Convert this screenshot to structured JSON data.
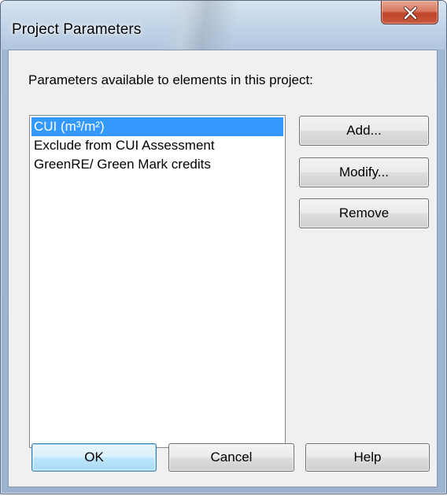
{
  "window": {
    "title": "Project Parameters",
    "colors": {
      "selection": "#3399ff",
      "close_button": "#c0432a",
      "default_button": "#3c7fb1"
    }
  },
  "dialog": {
    "caption": "Parameters available to elements in this project:",
    "parameters": [
      {
        "label": "CUI (m³/m²)",
        "selected": true
      },
      {
        "label": "Exclude from CUI Assessment",
        "selected": false
      },
      {
        "label": "GreenRE/ Green Mark credits",
        "selected": false
      }
    ],
    "buttons": {
      "add": "Add...",
      "modify": "Modify...",
      "remove": "Remove"
    },
    "footer": {
      "ok": "OK",
      "cancel": "Cancel",
      "help": "Help"
    }
  }
}
